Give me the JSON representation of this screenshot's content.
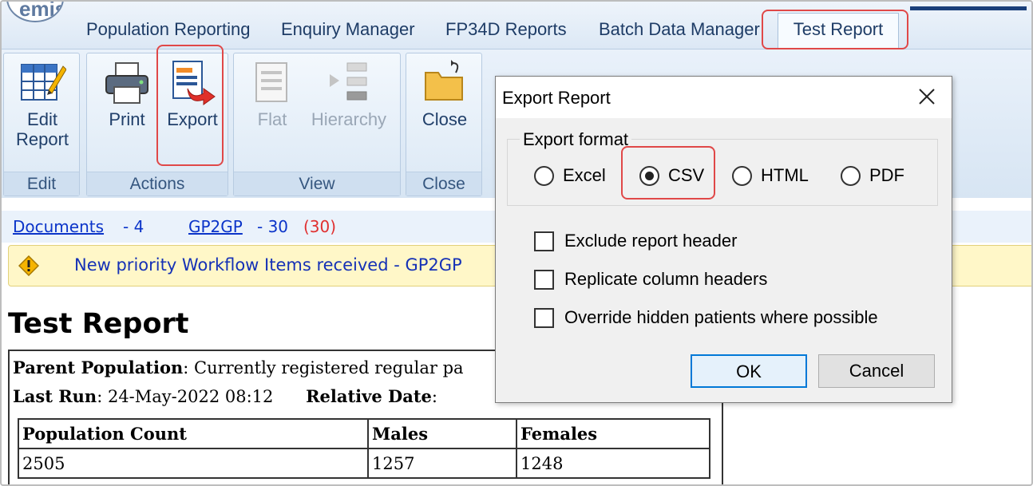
{
  "app": {
    "logo_text": "emis"
  },
  "tabs": [
    {
      "label": "Population Reporting"
    },
    {
      "label": "Enquiry Manager"
    },
    {
      "label": "FP34D Reports"
    },
    {
      "label": "Batch Data Manager"
    },
    {
      "label": "Test Report"
    }
  ],
  "ribbon": {
    "groups": {
      "edit": "Edit",
      "actions": "Actions",
      "view": "View",
      "close": "Close"
    },
    "buttons": {
      "edit_report_line1": "Edit",
      "edit_report_line2": "Report",
      "print": "Print",
      "export": "Export",
      "flat": "Flat",
      "hierarchy": "Hierarchy",
      "close": "Close"
    }
  },
  "status_links": {
    "documents_label": "Documents",
    "documents_count": "- 4",
    "gp2gp_label": "GP2GP",
    "gp2gp_count": "- 30",
    "gp2gp_extra": "(30)"
  },
  "alert": {
    "message": "New priority Workflow Items received - GP2GP"
  },
  "report": {
    "title": "Test Report",
    "parent_population_label": "Parent Population",
    "parent_population_value": ": Currently registered regular pa",
    "last_run_label": "Last Run",
    "last_run_value": ": 24-May-2022 08:12",
    "relative_date_label": "Relative Date",
    "relative_date_value": ":",
    "table": {
      "headers": [
        "Population Count",
        "Males",
        "Females"
      ],
      "rows": [
        [
          "2505",
          "1257",
          "1248"
        ]
      ]
    }
  },
  "dialog": {
    "title": "Export Report",
    "format_legend": "Export format",
    "formats": [
      {
        "label": "Excel",
        "selected": false
      },
      {
        "label": "CSV",
        "selected": true
      },
      {
        "label": "HTML",
        "selected": false
      },
      {
        "label": "PDF",
        "selected": false
      }
    ],
    "options": [
      {
        "label": "Exclude report header",
        "checked": false
      },
      {
        "label": "Replicate column headers",
        "checked": false
      },
      {
        "label": "Override hidden patients where possible",
        "checked": false
      }
    ],
    "ok_label": "OK",
    "cancel_label": "Cancel"
  },
  "colors": {
    "link_blue": "#0b34c9",
    "alert_red": "#e03030",
    "highlight_red": "#e04848",
    "alert_background": "#fff7c8"
  }
}
